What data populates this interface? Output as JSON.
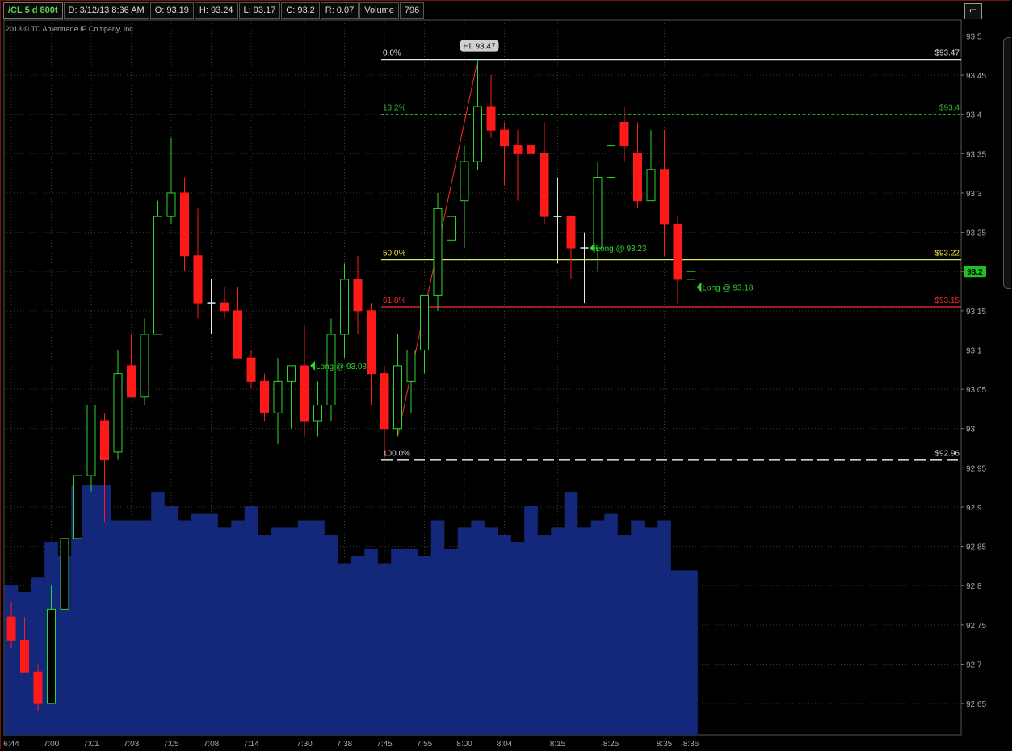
{
  "header": {
    "symbol": "/CL 5 d 800t",
    "date": "D: 3/12/13 8:36 AM",
    "open": "O: 93.19",
    "high": "H: 93.24",
    "low": "L: 93.17",
    "close": "C: 93.2",
    "range": "R: 0.07",
    "volume_label": "Volume",
    "volume_value": "796"
  },
  "copyright": "2013 © TD Ameritrade IP Company, Inc.",
  "icons": {
    "tool_button": "drawing-tool-icon"
  },
  "colors": {
    "up": "#2fd32f",
    "down": "#ff1a1a",
    "volume": "#13287a",
    "grid": "#3a3a3a",
    "fib_zero": "#ffffff",
    "fib_132": "#2fb82f",
    "fib_50": "#e6e64c",
    "fib_618": "#ff2a2a",
    "fib_100": "#cccccc"
  },
  "chart_data": {
    "type": "candlestick",
    "y_range": [
      92.61,
      93.52
    ],
    "y_ticks": [
      "93.5",
      "93.45",
      "93.4",
      "93.35",
      "93.3",
      "93.25",
      "93.2",
      "93.15",
      "93.1",
      "93.05",
      "93",
      "92.95",
      "92.9",
      "92.85",
      "92.8",
      "92.75",
      "92.7",
      "92.65"
    ],
    "x_labels": [
      "6:44",
      "7:00",
      "7:01",
      "7:03",
      "7:05",
      "7:08",
      "7:14",
      "7:30",
      "7:38",
      "7:45",
      "7:55",
      "8:00",
      "8:04",
      "8:15",
      "8:25",
      "8:35",
      "8:36"
    ],
    "x_label_bars": [
      0,
      3,
      6,
      9,
      12,
      15,
      18,
      22,
      25,
      28,
      31,
      34,
      37,
      41,
      45,
      49,
      51
    ],
    "last_price": "93.2",
    "candles": [
      {
        "o": 92.76,
        "h": 92.78,
        "l": 92.72,
        "c": 92.73
      },
      {
        "o": 92.73,
        "h": 92.76,
        "l": 92.69,
        "c": 92.69
      },
      {
        "o": 92.69,
        "h": 92.7,
        "l": 92.64,
        "c": 92.65
      },
      {
        "o": 92.65,
        "h": 92.8,
        "l": 92.65,
        "c": 92.77
      },
      {
        "o": 92.77,
        "h": 92.86,
        "l": 92.77,
        "c": 92.86
      },
      {
        "o": 92.86,
        "h": 92.95,
        "l": 92.84,
        "c": 92.94
      },
      {
        "o": 92.94,
        "h": 93.03,
        "l": 92.92,
        "c": 93.03
      },
      {
        "o": 93.01,
        "h": 93.02,
        "l": 92.88,
        "c": 92.96
      },
      {
        "o": 92.97,
        "h": 93.1,
        "l": 92.96,
        "c": 93.07
      },
      {
        "o": 93.08,
        "h": 93.12,
        "l": 93.04,
        "c": 93.04
      },
      {
        "o": 93.04,
        "h": 93.14,
        "l": 93.03,
        "c": 93.12
      },
      {
        "o": 93.12,
        "h": 93.29,
        "l": 93.12,
        "c": 93.27
      },
      {
        "o": 93.27,
        "h": 93.37,
        "l": 93.26,
        "c": 93.3
      },
      {
        "o": 93.3,
        "h": 93.32,
        "l": 93.2,
        "c": 93.22
      },
      {
        "o": 93.22,
        "h": 93.28,
        "l": 93.14,
        "c": 93.16
      },
      {
        "o": 93.16,
        "h": 93.19,
        "l": 93.12,
        "c": 93.16
      },
      {
        "o": 93.16,
        "h": 93.18,
        "l": 93.14,
        "c": 93.15
      },
      {
        "o": 93.15,
        "h": 93.18,
        "l": 93.09,
        "c": 93.09
      },
      {
        "o": 93.09,
        "h": 93.1,
        "l": 93.05,
        "c": 93.06
      },
      {
        "o": 93.06,
        "h": 93.07,
        "l": 93.01,
        "c": 93.02
      },
      {
        "o": 93.02,
        "h": 93.09,
        "l": 92.98,
        "c": 93.06
      },
      {
        "o": 93.06,
        "h": 93.08,
        "l": 93.0,
        "c": 93.08
      },
      {
        "o": 93.08,
        "h": 93.13,
        "l": 92.99,
        "c": 93.01
      },
      {
        "o": 93.01,
        "h": 93.06,
        "l": 92.99,
        "c": 93.03
      },
      {
        "o": 93.03,
        "h": 93.14,
        "l": 93.01,
        "c": 93.12
      },
      {
        "o": 93.12,
        "h": 93.21,
        "l": 93.09,
        "c": 93.19
      },
      {
        "o": 93.19,
        "h": 93.22,
        "l": 93.12,
        "c": 93.15
      },
      {
        "o": 93.15,
        "h": 93.16,
        "l": 93.03,
        "c": 93.07
      },
      {
        "o": 93.07,
        "h": 93.08,
        "l": 92.96,
        "c": 93.0
      },
      {
        "o": 93.0,
        "h": 93.12,
        "l": 92.99,
        "c": 93.08
      },
      {
        "o": 93.06,
        "h": 93.09,
        "l": 93.02,
        "c": 93.1
      },
      {
        "o": 93.1,
        "h": 93.17,
        "l": 93.07,
        "c": 93.17
      },
      {
        "o": 93.17,
        "h": 93.3,
        "l": 93.15,
        "c": 93.28
      },
      {
        "o": 93.24,
        "h": 93.32,
        "l": 93.22,
        "c": 93.27
      },
      {
        "o": 93.29,
        "h": 93.36,
        "l": 93.23,
        "c": 93.34
      },
      {
        "o": 93.34,
        "h": 93.47,
        "l": 93.33,
        "c": 93.41
      },
      {
        "o": 93.41,
        "h": 93.45,
        "l": 93.37,
        "c": 93.38
      },
      {
        "o": 93.38,
        "h": 93.39,
        "l": 93.31,
        "c": 93.36
      },
      {
        "o": 93.36,
        "h": 93.38,
        "l": 93.29,
        "c": 93.35
      },
      {
        "o": 93.36,
        "h": 93.41,
        "l": 93.33,
        "c": 93.35
      },
      {
        "o": 93.35,
        "h": 93.39,
        "l": 93.26,
        "c": 93.27
      },
      {
        "o": 93.27,
        "h": 93.32,
        "l": 93.21,
        "c": 93.27
      },
      {
        "o": 93.27,
        "h": 93.27,
        "l": 93.19,
        "c": 93.23
      },
      {
        "o": 93.23,
        "h": 93.25,
        "l": 93.16,
        "c": 93.23
      },
      {
        "o": 93.23,
        "h": 93.34,
        "l": 93.2,
        "c": 93.32
      },
      {
        "o": 93.32,
        "h": 93.39,
        "l": 93.3,
        "c": 93.36
      },
      {
        "o": 93.39,
        "h": 93.41,
        "l": 93.34,
        "c": 93.36
      },
      {
        "o": 93.35,
        "h": 93.39,
        "l": 93.28,
        "c": 93.29
      },
      {
        "o": 93.29,
        "h": 93.38,
        "l": 93.29,
        "c": 93.33
      },
      {
        "o": 93.33,
        "h": 93.38,
        "l": 93.22,
        "c": 93.26
      },
      {
        "o": 93.26,
        "h": 93.27,
        "l": 93.16,
        "c": 93.19
      },
      {
        "o": 93.19,
        "h": 93.24,
        "l": 93.17,
        "c": 93.2
      }
    ],
    "volume": [
      {
        "bar": 0,
        "v": 0.21
      },
      {
        "bar": 1,
        "v": 0.2
      },
      {
        "bar": 2,
        "v": 0.22
      },
      {
        "bar": 3,
        "v": 0.27
      },
      {
        "bar": 4,
        "v": 0.25
      },
      {
        "bar": 5,
        "v": 0.35
      },
      {
        "bar": 6,
        "v": 0.35
      },
      {
        "bar": 7,
        "v": 0.35
      },
      {
        "bar": 8,
        "v": 0.3
      },
      {
        "bar": 9,
        "v": 0.3
      },
      {
        "bar": 10,
        "v": 0.3
      },
      {
        "bar": 11,
        "v": 0.34
      },
      {
        "bar": 12,
        "v": 0.32
      },
      {
        "bar": 13,
        "v": 0.3
      },
      {
        "bar": 14,
        "v": 0.31
      },
      {
        "bar": 15,
        "v": 0.31
      },
      {
        "bar": 16,
        "v": 0.29
      },
      {
        "bar": 17,
        "v": 0.3
      },
      {
        "bar": 18,
        "v": 0.32
      },
      {
        "bar": 19,
        "v": 0.28
      },
      {
        "bar": 20,
        "v": 0.29
      },
      {
        "bar": 21,
        "v": 0.29
      },
      {
        "bar": 22,
        "v": 0.3
      },
      {
        "bar": 23,
        "v": 0.3
      },
      {
        "bar": 24,
        "v": 0.28
      },
      {
        "bar": 25,
        "v": 0.24
      },
      {
        "bar": 26,
        "v": 0.25
      },
      {
        "bar": 27,
        "v": 0.26
      },
      {
        "bar": 28,
        "v": 0.24
      },
      {
        "bar": 29,
        "v": 0.26
      },
      {
        "bar": 30,
        "v": 0.26
      },
      {
        "bar": 31,
        "v": 0.25
      },
      {
        "bar": 32,
        "v": 0.3
      },
      {
        "bar": 33,
        "v": 0.26
      },
      {
        "bar": 34,
        "v": 0.29
      },
      {
        "bar": 35,
        "v": 0.3
      },
      {
        "bar": 36,
        "v": 0.29
      },
      {
        "bar": 37,
        "v": 0.28
      },
      {
        "bar": 38,
        "v": 0.27
      },
      {
        "bar": 39,
        "v": 0.32
      },
      {
        "bar": 40,
        "v": 0.28
      },
      {
        "bar": 41,
        "v": 0.29
      },
      {
        "bar": 42,
        "v": 0.34
      },
      {
        "bar": 43,
        "v": 0.29
      },
      {
        "bar": 44,
        "v": 0.3
      },
      {
        "bar": 45,
        "v": 0.31
      },
      {
        "bar": 46,
        "v": 0.28
      },
      {
        "bar": 47,
        "v": 0.3
      },
      {
        "bar": 48,
        "v": 0.29
      },
      {
        "bar": 49,
        "v": 0.3
      },
      {
        "bar": 50,
        "v": 0.23
      },
      {
        "bar": 51,
        "v": 0.23
      }
    ],
    "fib_levels": [
      {
        "pct": "0.0%",
        "price": 93.47,
        "label": "$93.47",
        "style": "solid",
        "color": "#e8e8e8"
      },
      {
        "pct": "13.2%",
        "price": 93.4,
        "label": "$93.4",
        "style": "dotted",
        "color": "#2fb82f"
      },
      {
        "pct": "50.0%",
        "price": 93.215,
        "label": "$93.22",
        "style": "solid",
        "color": "#e6e64c"
      },
      {
        "pct": "61.8%",
        "price": 93.155,
        "label": "$93.15",
        "style": "solid",
        "color": "#ff2a2a"
      },
      {
        "pct": "100.0%",
        "price": 92.96,
        "label": "$92.96",
        "style": "dashed",
        "color": "#d0d0d0"
      }
    ],
    "fib_start_bar": 28,
    "high_marker": {
      "bar": 35,
      "price": 93.47,
      "label": "Hi: 93.47"
    },
    "trend_line": {
      "from": {
        "bar": 29,
        "price": 92.99
      },
      "to": {
        "bar": 35,
        "price": 93.47
      }
    },
    "trades": [
      {
        "bar": 22,
        "price": 93.08,
        "label": "Long @ 93.08"
      },
      {
        "bar": 43,
        "price": 93.23,
        "label": "Long @ 93.23"
      },
      {
        "bar": 51,
        "price": 93.18,
        "label": "Long @ 93.18"
      }
    ]
  }
}
